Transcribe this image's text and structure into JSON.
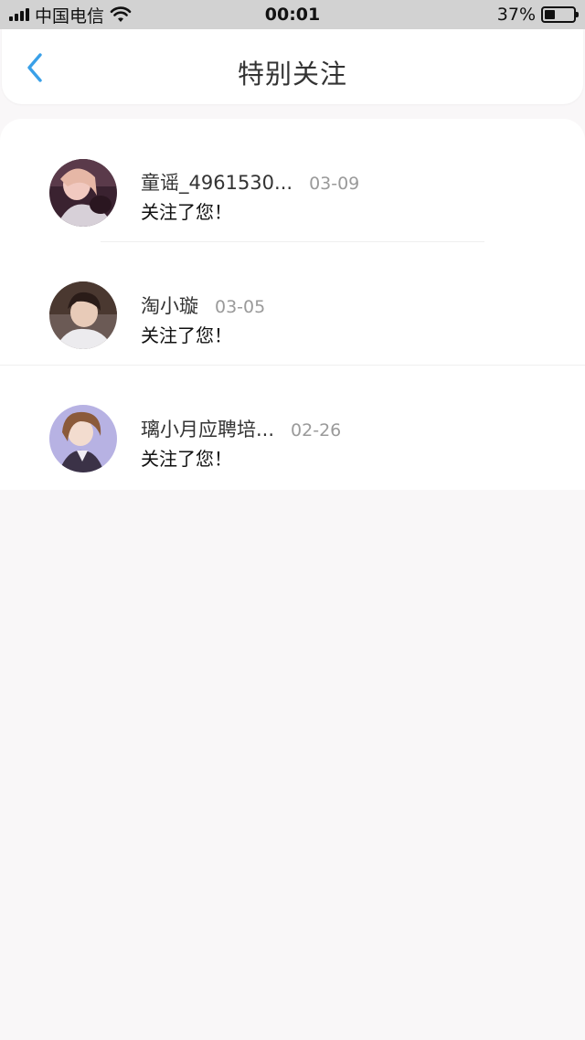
{
  "status_bar": {
    "carrier": "中国电信",
    "time": "00:01",
    "battery": "37%",
    "battery_level": 0.37
  },
  "nav": {
    "title": "特别关注",
    "back_icon": "chevron-left-icon",
    "accent_color": "#3aa0e8"
  },
  "follows": [
    {
      "name": "童谣_4961530...",
      "date": "03-09",
      "message": "关注了您！"
    },
    {
      "name": "淘小璇",
      "date": "03-05",
      "message": "关注了您！"
    },
    {
      "name": "璃小月应聘培...",
      "date": "02-26",
      "message": "关注了您！"
    }
  ]
}
